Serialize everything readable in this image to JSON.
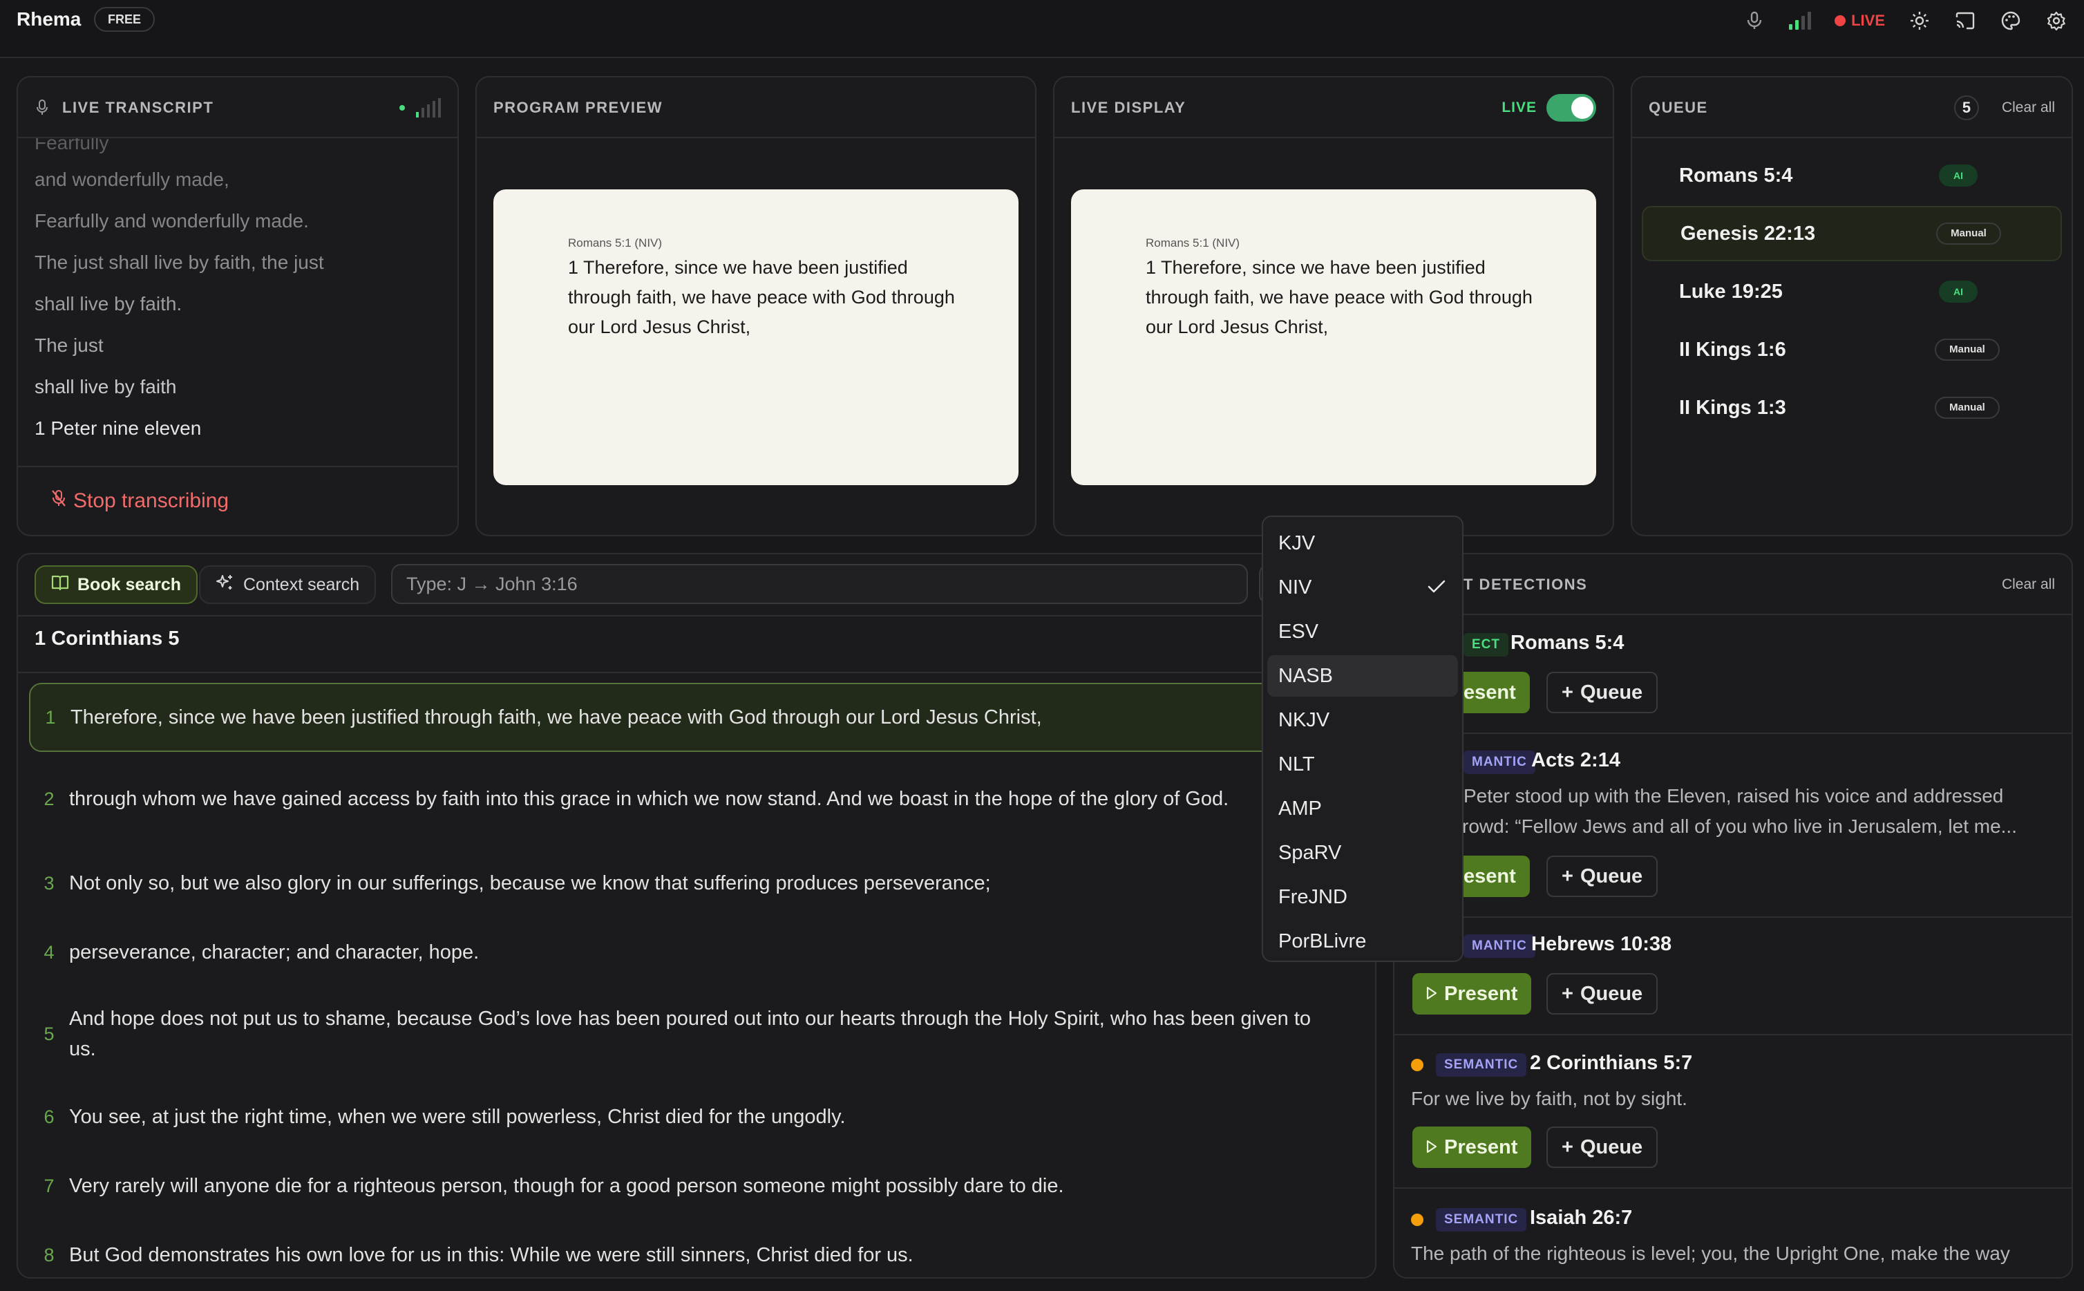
{
  "app": {
    "name": "Rhema",
    "plan": "FREE"
  },
  "topbar": {
    "live_label": "LIVE"
  },
  "transcript": {
    "title": "LIVE TRANSCRIPT",
    "lines": [
      "Fearfully",
      "and wonderfully made,",
      "Fearfully and wonderfully made.",
      "The just shall live by faith, the just",
      "shall live by faith.",
      "The just",
      "shall live by faith",
      "1 Peter nine eleven"
    ],
    "stop_label": "Stop transcribing"
  },
  "program_preview": {
    "title": "PROGRAM PREVIEW",
    "reference": "Romans 5:1 (NIV)",
    "text": "1 Therefore, since we have been justified through faith, we have peace with God through our Lord Jesus Christ,"
  },
  "live_display": {
    "title": "LIVE DISPLAY",
    "live_label": "LIVE",
    "reference": "Romans 5:1 (NIV)",
    "text": "1 Therefore, since we have been justified through faith, we have peace with God through our Lord Jesus Christ,"
  },
  "queue": {
    "title": "QUEUE",
    "count": "5",
    "clear_label": "Clear all",
    "items": [
      {
        "ref": "Romans 5:4",
        "tag": "AI"
      },
      {
        "ref": "Genesis 22:13",
        "tag": "Manual"
      },
      {
        "ref": "Luke 19:25",
        "tag": "AI"
      },
      {
        "ref": "II Kings 1:6",
        "tag": "Manual"
      },
      {
        "ref": "II Kings 1:3",
        "tag": "Manual"
      }
    ]
  },
  "search": {
    "book_search_label": "Book search",
    "context_search_label": "Context search",
    "placeholder": "Type: J → John 3:16",
    "chapter_title": "1 Corinthians 5",
    "verses": [
      {
        "num": "1",
        "text": "Therefore, since we have been justified through faith, we have peace with God through our Lord Jesus Christ,"
      },
      {
        "num": "2",
        "text": "through whom we have gained access by faith into this grace in which we now stand. And we boast in the hope of the glory of God."
      },
      {
        "num": "3",
        "text": "Not only so, but we also glory in our sufferings, because we know that suffering produces perseverance;"
      },
      {
        "num": "4",
        "text": "perseverance, character; and character, hope."
      },
      {
        "num": "5",
        "text": "And hope does not put us to shame, because God’s love has been poured out into our hearts through the Holy Spirit, who has been given to us."
      },
      {
        "num": "6",
        "text": "You see, at just the right time, when we were still powerless, Christ died for the ungodly."
      },
      {
        "num": "7",
        "text": "Very rarely will anyone die for a righteous person, though for a good person someone might possibly dare to die."
      },
      {
        "num": "8",
        "text": "But God demonstrates his own love for us in this: While we were still sinners, Christ died for us."
      }
    ]
  },
  "translation_dropdown": {
    "selected": "NIV",
    "options": [
      "KJV",
      "NIV",
      "ESV",
      "NASB",
      "NKJV",
      "NLT",
      "AMP",
      "SpaRV",
      "FreJND",
      "PorBLivre"
    ]
  },
  "detections": {
    "title_visible": "T DETECTIONS",
    "clear_label": "Clear all",
    "present_label": "Present",
    "queue_label": "Queue",
    "items": [
      {
        "badge": "ECT",
        "ref": "Romans 5:4",
        "text": "",
        "present_label": "esent"
      },
      {
        "badge": "MANTIC",
        "ref": "Acts 2:14",
        "text": "Peter stood up with the Eleven, raised his voice and addressed",
        "text2": "rowd: “Fellow Jews and all of you who live in Jerusalem, let me...",
        "present_label": "esent"
      },
      {
        "badge": "MANTIC",
        "ref": "Hebrews 10:38",
        "text": ""
      },
      {
        "badge": "SEMANTIC",
        "ref": "2 Corinthians 5:7",
        "text": "For we live by faith, not by sight."
      },
      {
        "badge": "SEMANTIC",
        "ref": "Isaiah 26:7",
        "text": "The path of the righteous is level; you, the Upright One, make the way"
      }
    ]
  },
  "colors": {
    "background": "#18181a",
    "accent_green": "#4f7a1f",
    "live_red": "#ef4444",
    "semantic_badge": "#a5a3f5",
    "detection_dot": "#f59e0b"
  }
}
